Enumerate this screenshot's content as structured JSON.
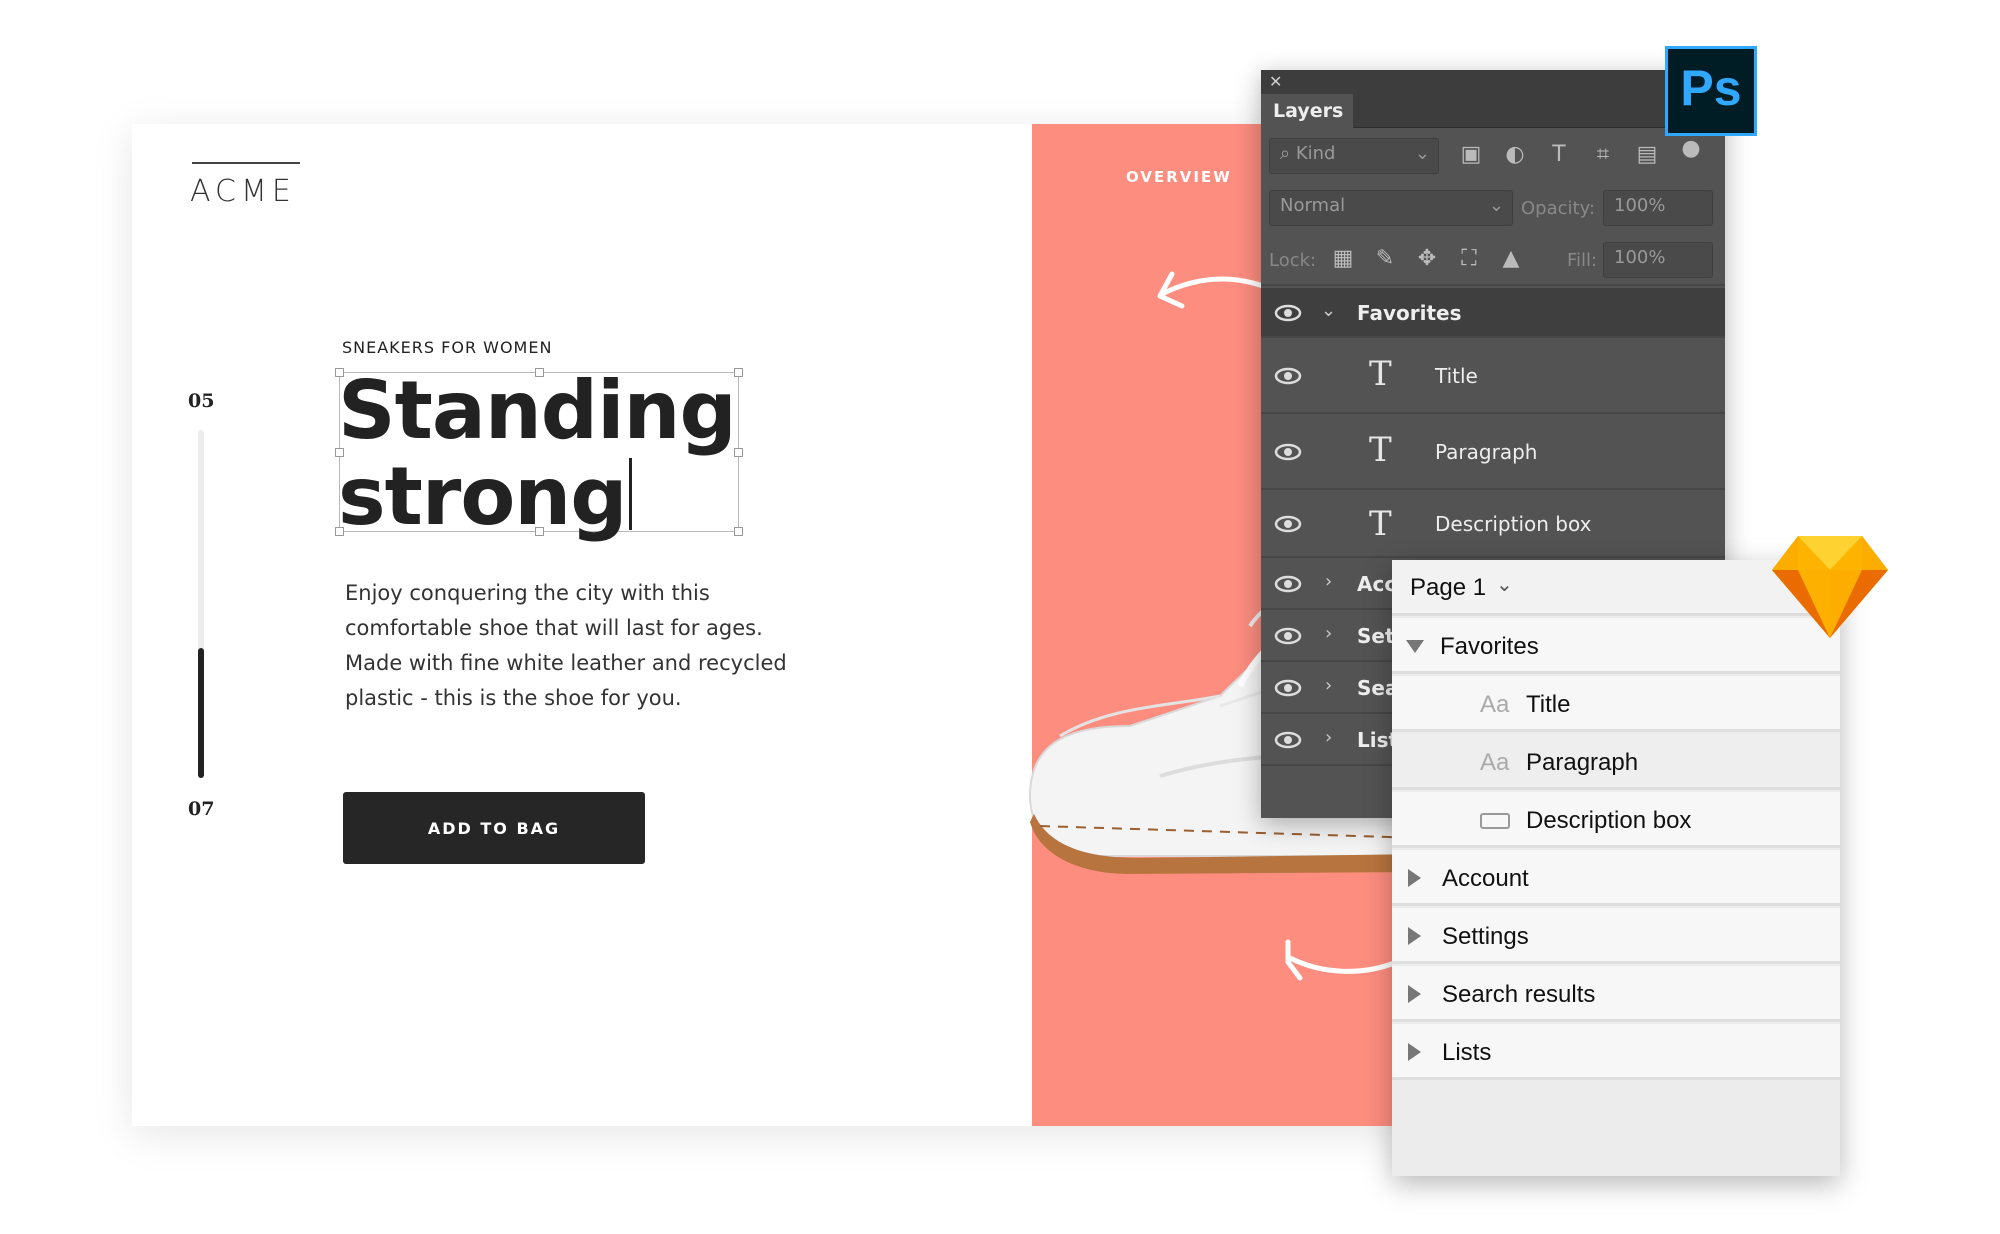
{
  "design": {
    "logo": "ACME",
    "step_top": "05",
    "step_bottom": "07",
    "step_progress": 0.38,
    "eyebrow": "SNEAKERS FOR WOMEN",
    "headline_line1": "Standing",
    "headline_line2": "strong",
    "description": "Enjoy conquering the city with this comfortable shoe that will last for ages. Made with fine white leather and recycled plastic - this is the shoe for you.",
    "cta_label": "ADD TO BAG",
    "nav_label": "OVERVIEW",
    "accent_color": "#fc8d7f"
  },
  "photoshop": {
    "panel_title": "Layers",
    "filter_placeholder": "Kind",
    "blend_mode": "Normal",
    "opacity_label": "Opacity:",
    "opacity_value": "100%",
    "lock_label": "Lock:",
    "fill_label": "Fill:",
    "fill_value": "100%",
    "logo_text": "Ps",
    "layers": [
      {
        "name": "Favorites",
        "type": "group",
        "expanded": true
      },
      {
        "name": "Title",
        "type": "text"
      },
      {
        "name": "Paragraph",
        "type": "text"
      },
      {
        "name": "Description box",
        "type": "text"
      },
      {
        "name": "Acc",
        "type": "group",
        "expanded": false
      },
      {
        "name": "Set",
        "type": "group",
        "expanded": false
      },
      {
        "name": "Sea",
        "type": "group",
        "expanded": false
      },
      {
        "name": "List",
        "type": "group",
        "expanded": false
      }
    ]
  },
  "sketch": {
    "page_selector": "Page 1",
    "group_name": "Favorites",
    "children": [
      {
        "icon": "Aa",
        "name": "Title"
      },
      {
        "icon": "Aa",
        "name": "Paragraph"
      },
      {
        "icon": "rectangle-icon",
        "name": "Description box"
      }
    ],
    "groups": [
      "Account",
      "Settings",
      "Search results",
      "Lists"
    ]
  }
}
